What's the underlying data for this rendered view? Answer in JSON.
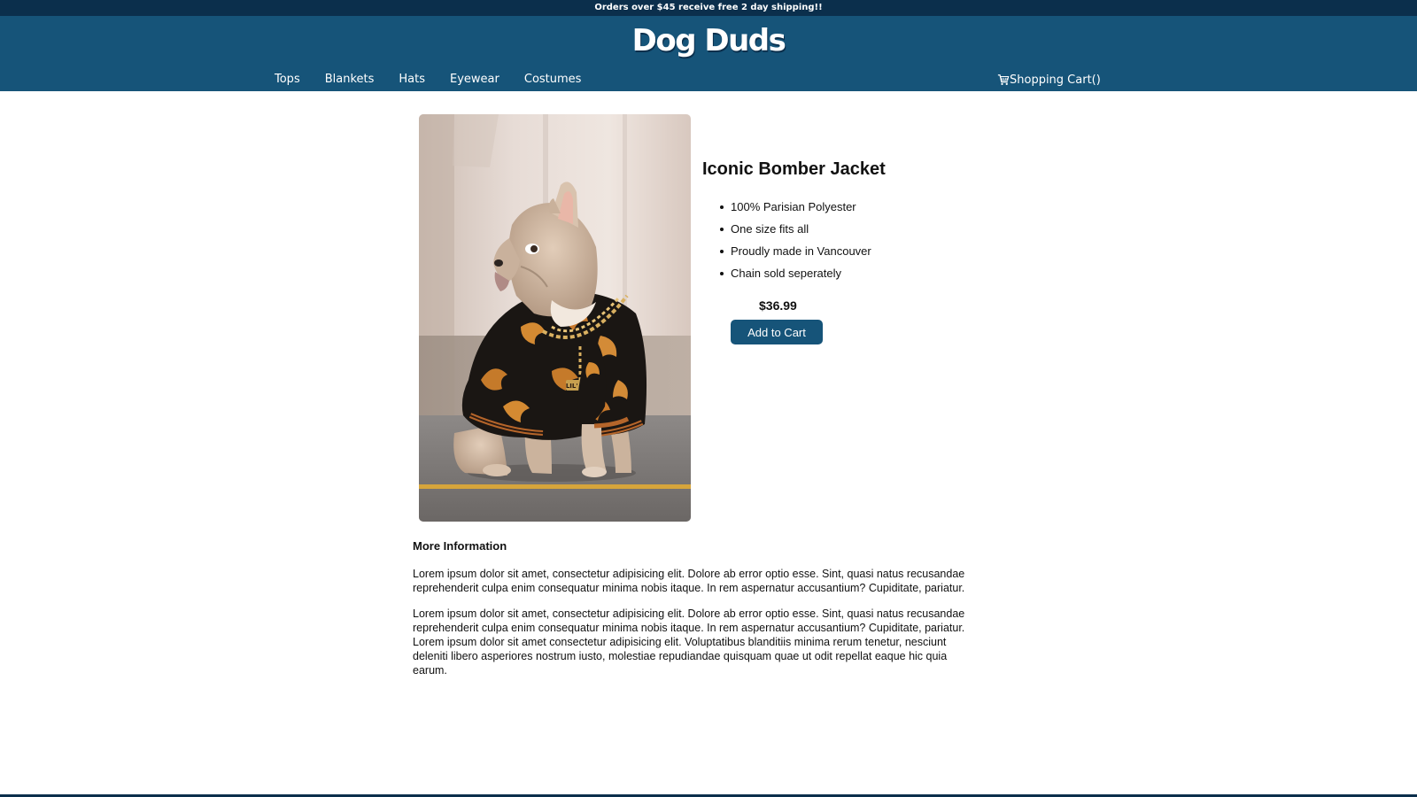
{
  "promo": {
    "text": "Orders over $45 receive free 2 day shipping!!"
  },
  "header": {
    "logo_text": "Dog Duds",
    "nav": [
      {
        "label": "Tops"
      },
      {
        "label": "Blankets"
      },
      {
        "label": "Hats"
      },
      {
        "label": "Eyewear"
      },
      {
        "label": "Costumes"
      }
    ],
    "cart_label": "Shopping Cart()",
    "cart_icon": "shopping-cart-icon"
  },
  "product": {
    "title": "Iconic Bomber Jacket",
    "features": [
      "100% Parisian Polyester",
      "One size fits all",
      "Proudly made in Vancouver",
      "Chain sold seperately"
    ],
    "price": "$36.99",
    "add_button": "Add to Cart",
    "tag_text": "LIL' MAN"
  },
  "more_info": {
    "heading": "More Information",
    "paragraphs": [
      "Lorem ipsum dolor sit amet, consectetur adipisicing elit. Dolore ab error optio esse. Sint, quasi natus recusandae reprehenderit culpa enim consequatur minima nobis itaque. In rem aspernatur accusantium? Cupiditate, pariatur.",
      "Lorem ipsum dolor sit amet, consectetur adipisicing elit. Dolore ab error optio esse. Sint, quasi natus recusandae reprehenderit culpa enim consequatur minima nobis itaque. In rem aspernatur accusantium? Cupiditate, pariatur. Lorem ipsum dolor sit amet consectetur adipisicing elit. Voluptatibus blanditiis minima rerum tenetur, nesciunt deleniti libero asperiores nostrum iusto, molestiae repudiandae quisquam quae ut odit repellat eaque hic quia earum."
    ]
  },
  "colors": {
    "header": "#165479",
    "promo_bar": "#0b2f4c",
    "button": "#165479"
  }
}
